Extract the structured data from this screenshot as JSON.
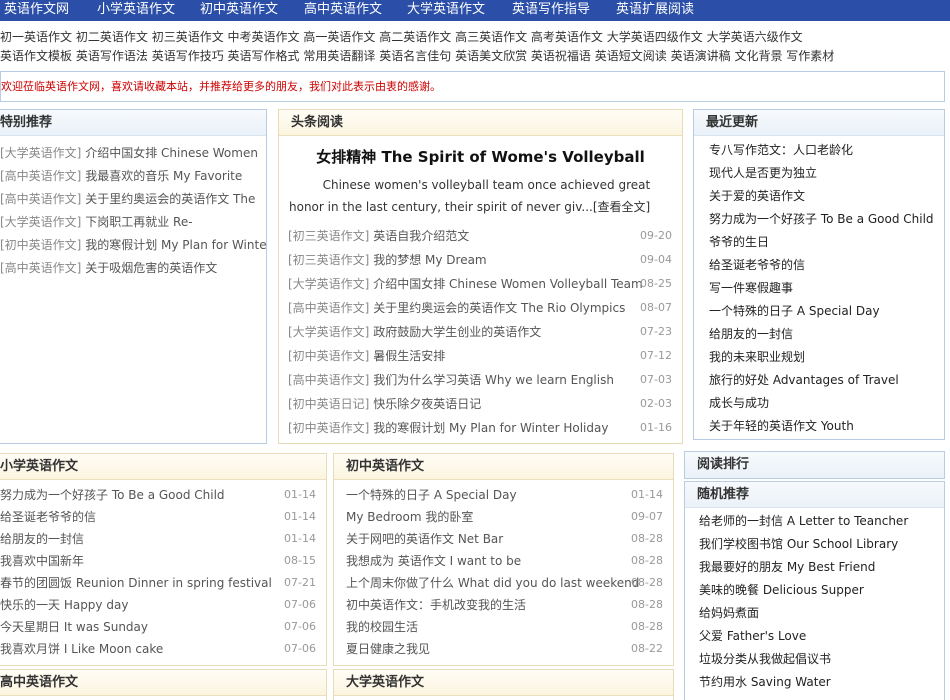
{
  "topnav": [
    "英语作文网",
    "小学英语作文",
    "初中英语作文",
    "高中英语作文",
    "大学英语作文",
    "英语写作指导",
    "英语扩展阅读"
  ],
  "subnav": {
    "row1": [
      "初一英语作文",
      "初二英语作文",
      "初三英语作文",
      "中考英语作文",
      "高一英语作文",
      "高二英语作文",
      "高三英语作文",
      "高考英语作文",
      "大学英语四级作文",
      "大学英语六级作文"
    ],
    "row2": [
      "英语作文模板",
      "英语写作语法",
      "英语写作技巧",
      "英语写作格式",
      "常用英语翻译",
      "英语名言佳句",
      "英语美文欣赏",
      "英语祝福语",
      "英语短文阅读",
      "英语演讲稿",
      "文化背景",
      "写作素材"
    ]
  },
  "welcome": "欢迎莅临英语作文网，喜欢请收藏本站，并推荐给更多的朋友，我们对此表示由衷的感谢。",
  "special": {
    "title": "特别推荐",
    "items": [
      {
        "cat": "[大学英语作文]",
        "title": "介绍中国女排 Chinese Women"
      },
      {
        "cat": "[高中英语作文]",
        "title": "我最喜欢的音乐 My Favorite"
      },
      {
        "cat": "[高中英语作文]",
        "title": "关于里约奥运会的英语作文 The"
      },
      {
        "cat": "[大学英语作文]",
        "title": "下岗职工再就业 Re-"
      },
      {
        "cat": "[初中英语作文]",
        "title": "我的寒假计划 My Plan for Winte"
      },
      {
        "cat": "[高中英语作文]",
        "title": "关于吸烟危害的英语作文"
      }
    ]
  },
  "headlines": {
    "title": "头条阅读",
    "main_title": "女排精神 The Spirit of Wome's Volleyball",
    "summary": "Chinese women's volleyball team once achieved great honor in the last century, their spirit of never giv...",
    "more": "[查看全文]",
    "items": [
      {
        "cat": "[初三英语作文]",
        "title": "英语自我介绍范文",
        "date": "09-20"
      },
      {
        "cat": "[初三英语作文]",
        "title": "我的梦想 My Dream",
        "date": "09-04"
      },
      {
        "cat": "[大学英语作文]",
        "title": "介绍中国女排 Chinese Women Volleyball Team",
        "date": "08-25"
      },
      {
        "cat": "[高中英语作文]",
        "title": "关于里约奥运会的英语作文 The Rio Olympics",
        "date": "08-07"
      },
      {
        "cat": "[大学英语作文]",
        "title": "政府鼓励大学生创业的英语作文",
        "date": "07-23"
      },
      {
        "cat": "[初中英语作文]",
        "title": "暑假生活安排",
        "date": "07-12"
      },
      {
        "cat": "[高中英语作文]",
        "title": "我们为什么学习英语 Why we learn English",
        "date": "07-03"
      },
      {
        "cat": "[初中英语日记]",
        "title": "快乐除夕夜英语日记",
        "date": "02-03"
      },
      {
        "cat": "[初中英语作文]",
        "title": "我的寒假计划 My Plan for Winter Holiday",
        "date": "01-16"
      }
    ]
  },
  "recent": {
    "title": "最近更新",
    "items": [
      "专八写作范文：人口老龄化",
      "现代人是否更为独立",
      "关于爱的英语作文",
      "努力成为一个好孩子 To Be a Good Child",
      "爷爷的生日",
      "给圣诞老爷爷的信",
      "写一件寒假趣事",
      "一个特殊的日子 A Special Day",
      "给朋友的一封信",
      "我的未来职业规划",
      "旅行的好处 Advantages of Travel",
      "成长与成功",
      "关于年轻的英语作文 Youth"
    ]
  },
  "primary": {
    "title": "小学英语作文",
    "items": [
      {
        "title": "努力成为一个好孩子 To Be a Good Child",
        "date": "01-14"
      },
      {
        "title": "给圣诞老爷爷的信",
        "date": "01-14"
      },
      {
        "title": "给朋友的一封信",
        "date": "01-14"
      },
      {
        "title": "我喜欢中国新年",
        "date": "08-15"
      },
      {
        "title": "春节的团圆饭 Reunion Dinner in spring festival",
        "date": "07-21"
      },
      {
        "title": "快乐的一天 Happy day",
        "date": "07-06"
      },
      {
        "title": "今天星期日 It was Sunday",
        "date": "07-06"
      },
      {
        "title": "我喜欢月饼 I Like Moon cake",
        "date": "07-06"
      }
    ]
  },
  "junior": {
    "title": "初中英语作文",
    "items": [
      {
        "title": "一个特殊的日子 A Special Day",
        "date": "01-14"
      },
      {
        "title": "My Bedroom 我的卧室",
        "date": "09-07"
      },
      {
        "title": "关于网吧的英语作文 Net Bar",
        "date": "08-28"
      },
      {
        "title": "我想成为 英语作文 I want to be",
        "date": "08-28"
      },
      {
        "title": "上个周末你做了什么 What did you do last weekend",
        "date": "08-28"
      },
      {
        "title": "初中英语作文：手机改变我的生活",
        "date": "08-28"
      },
      {
        "title": "我的校园生活",
        "date": "08-28"
      },
      {
        "title": "夏日健康之我见",
        "date": "08-22"
      }
    ]
  },
  "ranking": {
    "title": "阅读排行"
  },
  "random": {
    "title": "随机推荐",
    "items": [
      "给老师的一封信 A Letter to Teancher",
      "我们学校图书馆 Our School Library",
      "我最要好的朋友 My Best Friend",
      "美味的晚餐 Delicious Supper",
      "给妈妈煮面",
      "父爱 Father's Love",
      "垃圾分类从我做起倡议书",
      "节约用水 Saving Water"
    ]
  },
  "senior": {
    "title": "高中英语作文"
  },
  "college": {
    "title": "大学英语作文"
  }
}
